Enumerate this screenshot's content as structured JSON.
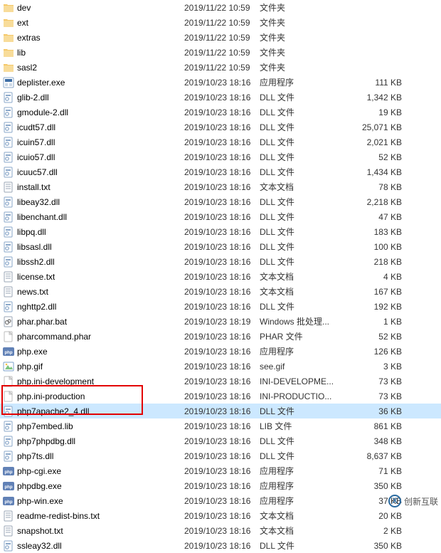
{
  "watermark": "创新互联",
  "icons": {
    "folder": "folder",
    "exe": "exe",
    "dll": "dll",
    "txt": "txt",
    "lib": "dll",
    "bat": "bat",
    "phar": "file",
    "phpexe": "phpexe",
    "gif": "gif",
    "ini": "file"
  },
  "files": [
    {
      "icon": "folder",
      "name": "dev",
      "date": "2019/11/22 10:59",
      "type": "文件夹",
      "size": "",
      "sel": false
    },
    {
      "icon": "folder",
      "name": "ext",
      "date": "2019/11/22 10:59",
      "type": "文件夹",
      "size": "",
      "sel": false
    },
    {
      "icon": "folder",
      "name": "extras",
      "date": "2019/11/22 10:59",
      "type": "文件夹",
      "size": "",
      "sel": false
    },
    {
      "icon": "folder",
      "name": "lib",
      "date": "2019/11/22 10:59",
      "type": "文件夹",
      "size": "",
      "sel": false
    },
    {
      "icon": "folder",
      "name": "sasl2",
      "date": "2019/11/22 10:59",
      "type": "文件夹",
      "size": "",
      "sel": false
    },
    {
      "icon": "exe",
      "name": "deplister.exe",
      "date": "2019/10/23 18:16",
      "type": "应用程序",
      "size": "111 KB",
      "sel": false
    },
    {
      "icon": "dll",
      "name": "glib-2.dll",
      "date": "2019/10/23 18:16",
      "type": "DLL 文件",
      "size": "1,342 KB",
      "sel": false
    },
    {
      "icon": "dll",
      "name": "gmodule-2.dll",
      "date": "2019/10/23 18:16",
      "type": "DLL 文件",
      "size": "19 KB",
      "sel": false
    },
    {
      "icon": "dll",
      "name": "icudt57.dll",
      "date": "2019/10/23 18:16",
      "type": "DLL 文件",
      "size": "25,071 KB",
      "sel": false
    },
    {
      "icon": "dll",
      "name": "icuin57.dll",
      "date": "2019/10/23 18:16",
      "type": "DLL 文件",
      "size": "2,021 KB",
      "sel": false
    },
    {
      "icon": "dll",
      "name": "icuio57.dll",
      "date": "2019/10/23 18:16",
      "type": "DLL 文件",
      "size": "52 KB",
      "sel": false
    },
    {
      "icon": "dll",
      "name": "icuuc57.dll",
      "date": "2019/10/23 18:16",
      "type": "DLL 文件",
      "size": "1,434 KB",
      "sel": false
    },
    {
      "icon": "txt",
      "name": "install.txt",
      "date": "2019/10/23 18:16",
      "type": "文本文档",
      "size": "78 KB",
      "sel": false
    },
    {
      "icon": "dll",
      "name": "libeay32.dll",
      "date": "2019/10/23 18:16",
      "type": "DLL 文件",
      "size": "2,218 KB",
      "sel": false
    },
    {
      "icon": "dll",
      "name": "libenchant.dll",
      "date": "2019/10/23 18:16",
      "type": "DLL 文件",
      "size": "47 KB",
      "sel": false
    },
    {
      "icon": "dll",
      "name": "libpq.dll",
      "date": "2019/10/23 18:16",
      "type": "DLL 文件",
      "size": "183 KB",
      "sel": false
    },
    {
      "icon": "dll",
      "name": "libsasl.dll",
      "date": "2019/10/23 18:16",
      "type": "DLL 文件",
      "size": "100 KB",
      "sel": false
    },
    {
      "icon": "dll",
      "name": "libssh2.dll",
      "date": "2019/10/23 18:16",
      "type": "DLL 文件",
      "size": "218 KB",
      "sel": false
    },
    {
      "icon": "txt",
      "name": "license.txt",
      "date": "2019/10/23 18:16",
      "type": "文本文档",
      "size": "4 KB",
      "sel": false
    },
    {
      "icon": "txt",
      "name": "news.txt",
      "date": "2019/10/23 18:16",
      "type": "文本文档",
      "size": "167 KB",
      "sel": false
    },
    {
      "icon": "dll",
      "name": "nghttp2.dll",
      "date": "2019/10/23 18:16",
      "type": "DLL 文件",
      "size": "192 KB",
      "sel": false
    },
    {
      "icon": "bat",
      "name": "phar.phar.bat",
      "date": "2019/10/23 18:19",
      "type": "Windows 批处理...",
      "size": "1 KB",
      "sel": false
    },
    {
      "icon": "phar",
      "name": "pharcommand.phar",
      "date": "2019/10/23 18:16",
      "type": "PHAR 文件",
      "size": "52 KB",
      "sel": false
    },
    {
      "icon": "phpexe",
      "name": "php.exe",
      "date": "2019/10/23 18:16",
      "type": "应用程序",
      "size": "126 KB",
      "sel": false
    },
    {
      "icon": "gif",
      "name": "php.gif",
      "date": "2019/10/23 18:16",
      "type": "see.gif",
      "size": "3 KB",
      "sel": false
    },
    {
      "icon": "ini",
      "name": "php.ini-development",
      "date": "2019/10/23 18:16",
      "type": "INI-DEVELOPME...",
      "size": "73 KB",
      "sel": false
    },
    {
      "icon": "ini",
      "name": "php.ini-production",
      "date": "2019/10/23 18:16",
      "type": "INI-PRODUCTIO...",
      "size": "73 KB",
      "sel": false
    },
    {
      "icon": "dll",
      "name": "php7apache2_4.dll",
      "date": "2019/10/23 18:16",
      "type": "DLL 文件",
      "size": "36 KB",
      "sel": true
    },
    {
      "icon": "lib",
      "name": "php7embed.lib",
      "date": "2019/10/23 18:16",
      "type": "LIB 文件",
      "size": "861 KB",
      "sel": false
    },
    {
      "icon": "dll",
      "name": "php7phpdbg.dll",
      "date": "2019/10/23 18:16",
      "type": "DLL 文件",
      "size": "348 KB",
      "sel": false
    },
    {
      "icon": "dll",
      "name": "php7ts.dll",
      "date": "2019/10/23 18:16",
      "type": "DLL 文件",
      "size": "8,637 KB",
      "sel": false
    },
    {
      "icon": "phpexe",
      "name": "php-cgi.exe",
      "date": "2019/10/23 18:16",
      "type": "应用程序",
      "size": "71 KB",
      "sel": false
    },
    {
      "icon": "phpexe",
      "name": "phpdbg.exe",
      "date": "2019/10/23 18:16",
      "type": "应用程序",
      "size": "350 KB",
      "sel": false
    },
    {
      "icon": "phpexe",
      "name": "php-win.exe",
      "date": "2019/10/23 18:16",
      "type": "应用程序",
      "size": "37 KB",
      "sel": false
    },
    {
      "icon": "txt",
      "name": "readme-redist-bins.txt",
      "date": "2019/10/23 18:16",
      "type": "文本文档",
      "size": "20 KB",
      "sel": false
    },
    {
      "icon": "txt",
      "name": "snapshot.txt",
      "date": "2019/10/23 18:16",
      "type": "文本文档",
      "size": "2 KB",
      "sel": false
    },
    {
      "icon": "dll",
      "name": "ssleay32.dll",
      "date": "2019/10/23 18:16",
      "type": "DLL 文件",
      "size": "350 KB",
      "sel": false
    }
  ]
}
